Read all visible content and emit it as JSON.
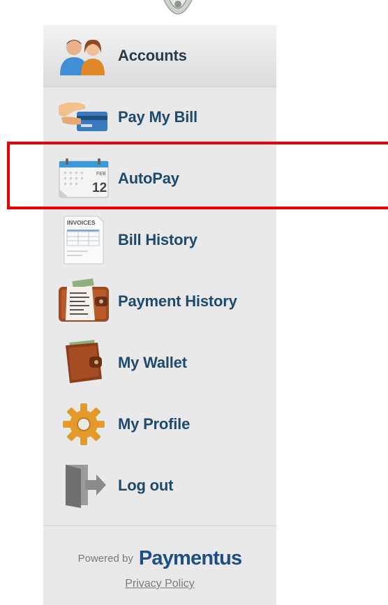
{
  "nav": {
    "items": [
      {
        "label": "Accounts",
        "icon": "users-icon",
        "active": true
      },
      {
        "label": "Pay My Bill",
        "icon": "credit-card-hand-icon"
      },
      {
        "label": "AutoPay",
        "icon": "calendar-icon",
        "icon_text_month": "FEB",
        "icon_text_day": "12"
      },
      {
        "label": "Bill History",
        "icon": "invoice-icon",
        "icon_text": "INVOICES"
      },
      {
        "label": "Payment History",
        "icon": "wallet-receipt-icon"
      },
      {
        "label": "My Wallet",
        "icon": "wallet-icon"
      },
      {
        "label": "My Profile",
        "icon": "gear-icon"
      },
      {
        "label": "Log out",
        "icon": "logout-door-icon"
      }
    ]
  },
  "footer": {
    "powered_by": "Powered by",
    "brand": "Paymentus",
    "privacy": "Privacy Policy"
  },
  "colors": {
    "label": "#1d4a6e",
    "brand": "#1e4e86",
    "highlight": "#ee0000",
    "sidebar_bg": "#e9e9e9"
  }
}
